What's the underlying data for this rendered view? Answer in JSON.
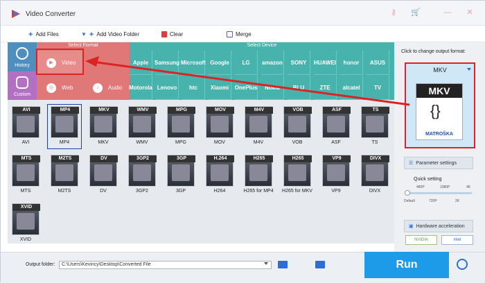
{
  "app": {
    "title": "Video Converter",
    "colors": {
      "accent": "#2b6fd6",
      "run": "#1e9be8",
      "highlight": "#dd2222",
      "format_panel": "#e07878",
      "device_panel": "#47b3ac"
    }
  },
  "toolbar": {
    "add_files": "Add Files",
    "add_video_folder": "Add Video Folder",
    "clear": "Clear",
    "merge": "Merge"
  },
  "sidenav": {
    "history": "History",
    "custom": "Custom"
  },
  "select_format": {
    "header": "Select Format",
    "video": "Video",
    "web": "Web",
    "audio": "Audio"
  },
  "select_device": {
    "header": "Select Device",
    "devices": [
      "Apple",
      "Samsung",
      "Microsoft",
      "Google",
      "LG",
      "amazon",
      "SONY",
      "HUAWEI",
      "honor",
      "ASUS",
      "Motorola",
      "Lenovo",
      "htc",
      "Xiaomi",
      "OnePlus",
      "Nokia",
      "BLU",
      "ZTE",
      "alcatel",
      "TV"
    ]
  },
  "formats": [
    {
      "tag": "AVI",
      "name": "AVI"
    },
    {
      "tag": "MP4",
      "name": "MP4",
      "selected": true
    },
    {
      "tag": "MKV",
      "name": "MKV"
    },
    {
      "tag": "WMV",
      "name": "WMV"
    },
    {
      "tag": "MPG",
      "name": "MPG"
    },
    {
      "tag": "MOV",
      "name": "MOV"
    },
    {
      "tag": "M4V",
      "name": "M4V"
    },
    {
      "tag": "VOB",
      "name": "VOB"
    },
    {
      "tag": "ASF",
      "name": "ASF"
    },
    {
      "tag": "TS",
      "name": "TS"
    },
    {
      "tag": "MTS",
      "name": "MTS"
    },
    {
      "tag": "M2TS",
      "name": "M2TS"
    },
    {
      "tag": "DV",
      "name": "DV"
    },
    {
      "tag": "3GP2",
      "name": "3GP2"
    },
    {
      "tag": "3GP",
      "name": "3GP"
    },
    {
      "tag": "H.264",
      "name": "H264"
    },
    {
      "tag": "H265",
      "name": "H265 for MP4"
    },
    {
      "tag": "H265",
      "name": "H265 for MKV"
    },
    {
      "tag": "VP9",
      "name": "VP9"
    },
    {
      "tag": "DIVX",
      "name": "DIVX"
    },
    {
      "tag": "XVID",
      "name": "XVID"
    }
  ],
  "right": {
    "hint": "Click to change output format:",
    "output_format": "MKV",
    "output_sub": "MATROŠKA",
    "parameter_settings": "Parameter settings",
    "quick_setting": "Quick setting",
    "quality_top": [
      "480P",
      "1080P",
      "4K"
    ],
    "quality_bottom": [
      "Default",
      "720P",
      "2K"
    ],
    "hardware_acceleration": "Hardware acceleration",
    "nvidia": "NVIDIA",
    "intel": "intel"
  },
  "bottom": {
    "output_folder_label": "Output folder:",
    "output_folder_value": "C:\\Users\\Kevincy\\Desktop\\Converted File",
    "run": "Run"
  }
}
